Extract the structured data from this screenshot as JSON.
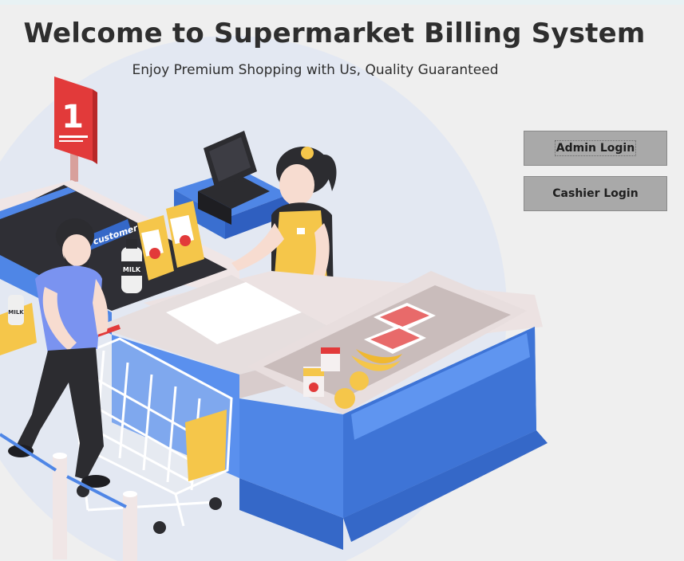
{
  "header": {
    "title": "Welcome to Supermarket Billing System",
    "subtitle": "Enjoy Premium Shopping with Us, Quality Guaranteed"
  },
  "buttons": {
    "admin_label": "Admin Login",
    "cashier_label": "Cashier Login"
  },
  "illustration": {
    "lane_number": "1",
    "banner_text": "customer",
    "product_label": "MILK",
    "colors": {
      "counter_blue": "#4f86e6",
      "counter_top": "#ece2e2",
      "lane_sign": "#e23a3a",
      "cashier_apron": "#f5c64a",
      "shopper_shirt": "#7a93f0"
    }
  }
}
